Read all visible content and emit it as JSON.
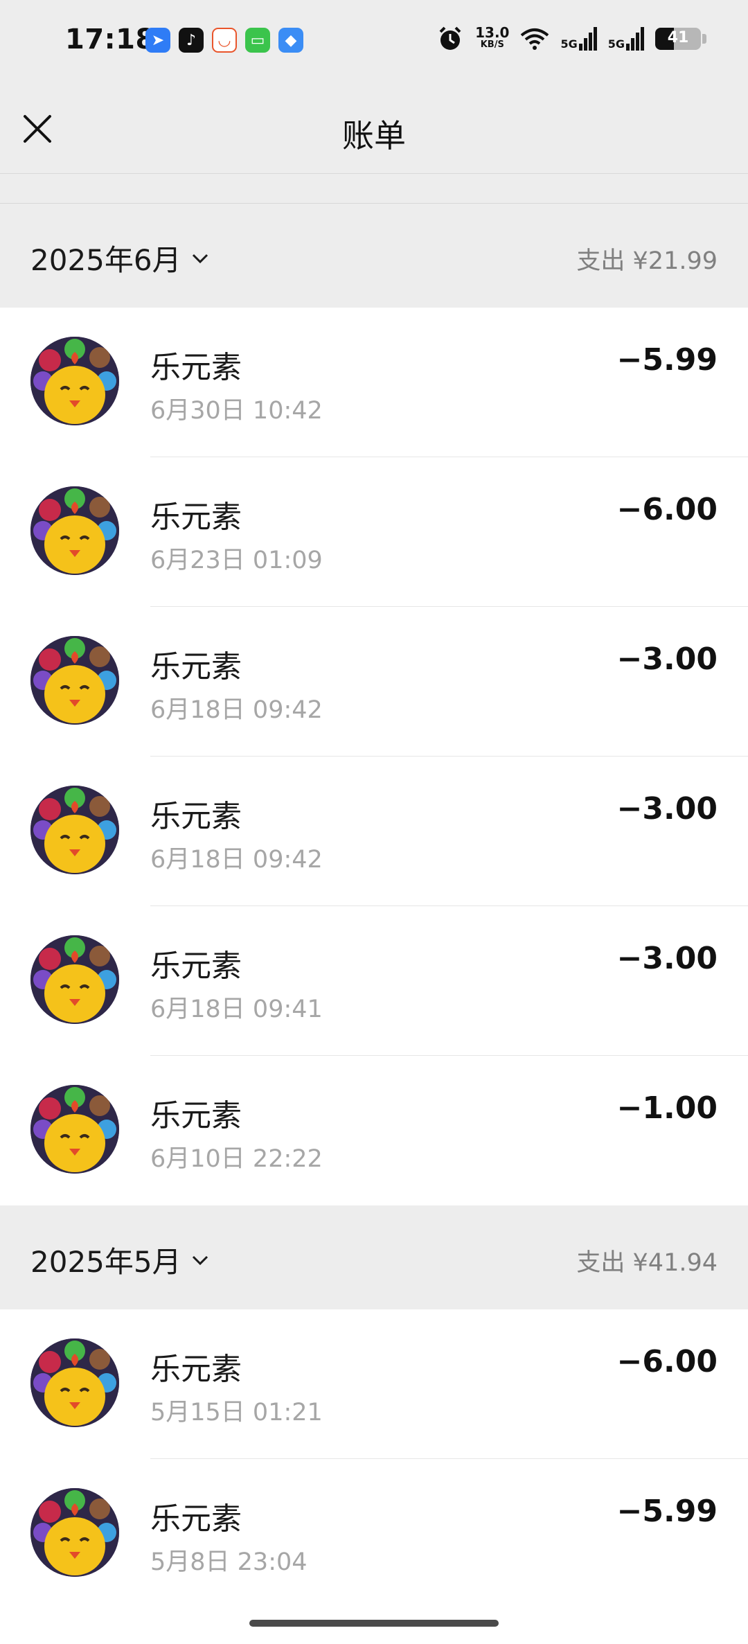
{
  "status_bar": {
    "time": "17:18",
    "net_speed": "13.0",
    "net_unit": "KB/S",
    "signal_1": "5G",
    "signal_2": "5G",
    "battery": "41"
  },
  "nav": {
    "title": "账单"
  },
  "months": [
    {
      "label": "2025年6月",
      "summary": "支出 ¥21.99",
      "items": [
        {
          "name": "乐元素",
          "time": "6月30日 10:42",
          "amount": "−5.99"
        },
        {
          "name": "乐元素",
          "time": "6月23日 01:09",
          "amount": "−6.00"
        },
        {
          "name": "乐元素",
          "time": "6月18日 09:42",
          "amount": "−3.00"
        },
        {
          "name": "乐元素",
          "time": "6月18日 09:42",
          "amount": "−3.00"
        },
        {
          "name": "乐元素",
          "time": "6月18日 09:41",
          "amount": "−3.00"
        },
        {
          "name": "乐元素",
          "time": "6月10日 22:22",
          "amount": "−1.00"
        }
      ]
    },
    {
      "label": "2025年5月",
      "summary": "支出 ¥41.94",
      "items": [
        {
          "name": "乐元素",
          "time": "5月15日 01:21",
          "amount": "−6.00"
        },
        {
          "name": "乐元素",
          "time": "5月8日 23:04",
          "amount": "−5.99"
        }
      ]
    }
  ],
  "icons": {
    "close": "close-icon",
    "month_toggle": "chevron-down-icon",
    "avatar": "merchant-avatar-icon"
  }
}
